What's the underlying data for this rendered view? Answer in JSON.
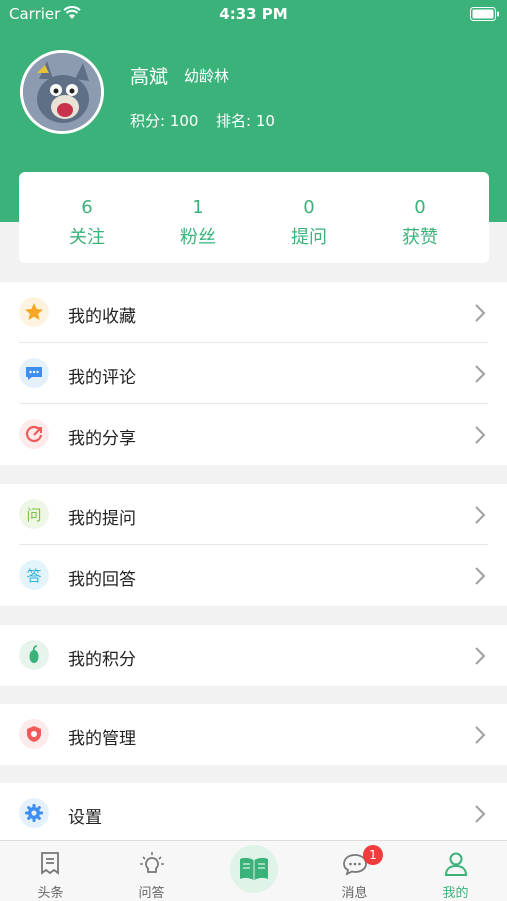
{
  "status_bar": {
    "carrier": "Carrier",
    "time": "4:33 PM"
  },
  "profile": {
    "name": "高斌",
    "age_group": "幼龄林",
    "score": "积分: 100",
    "rank": "排名: 10"
  },
  "stats": [
    {
      "value": "6",
      "label": "关注"
    },
    {
      "value": "1",
      "label": "粉丝"
    },
    {
      "value": "0",
      "label": "提问"
    },
    {
      "value": "0",
      "label": "获赞"
    }
  ],
  "menu": {
    "favorites": "我的收藏",
    "comments": "我的评论",
    "shares": "我的分享",
    "questions": "我的提问",
    "answers": "我的回答",
    "points": "我的积分",
    "manage": "我的管理",
    "settings": "设置"
  },
  "tabbar": {
    "headlines": "头条",
    "qa": "问答",
    "messages": "消息",
    "mine": "我的",
    "messages_badge": "1"
  },
  "colors": {
    "accent": "#3cb27b",
    "badge": "#f03c3c"
  }
}
